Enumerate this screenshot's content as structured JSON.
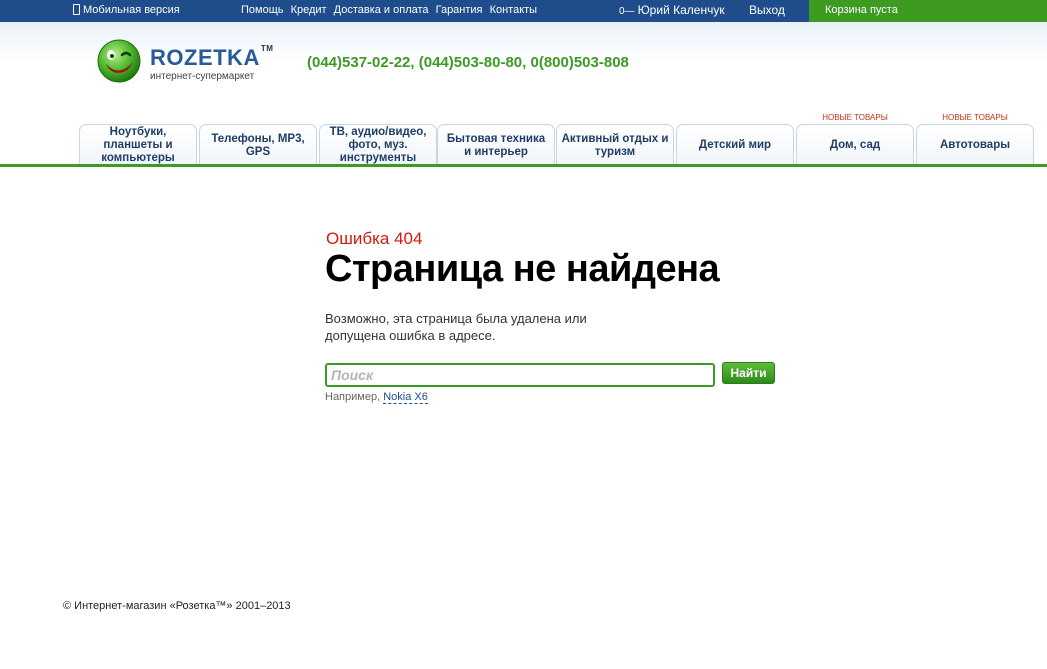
{
  "topbar": {
    "mobile": "Мобильная версия",
    "links": [
      "Помощь",
      "Кредит",
      "Доставка и оплата",
      "Гарантия",
      "Контакты"
    ],
    "user_key": "0—",
    "user": "Юрий Каленчук",
    "logout": "Выход",
    "cart": "Корзина пуста"
  },
  "header": {
    "logo": "ROZETKA",
    "logo_tm": "TM",
    "logo_sub": "интернет-супермаркет",
    "phones": "(044)537-02-22, (044)503-80-80, 0(800)503-808"
  },
  "categories": [
    {
      "label": "Ноутбуки, планшеты и компьютеры",
      "badge": ""
    },
    {
      "label": "Телефоны, MP3, GPS",
      "badge": ""
    },
    {
      "label": "ТВ, аудио/видео, фото, муз. инструменты",
      "badge": ""
    },
    {
      "label": "Бытовая техника и интерьер",
      "badge": ""
    },
    {
      "label": "Активный отдых и туризм",
      "badge": ""
    },
    {
      "label": "Детский мир",
      "badge": ""
    },
    {
      "label": "Дом, сад",
      "badge": "НОВЫЕ ТОВАРЫ"
    },
    {
      "label": "Автотовары",
      "badge": "НОВЫЕ ТОВАРЫ"
    }
  ],
  "main": {
    "error_code": "Ошибка 404",
    "title": "Страница не найдена",
    "description": "Возможно, эта страница была удалена или допущена ошибка в адресе.",
    "search_placeholder": "Поиск",
    "search_button": "Найти",
    "example_prefix": "Например,",
    "example_link": "Nokia X6"
  },
  "footer": {
    "copyright": "© Интернет-магазин «Розетка™» 2001–2013"
  },
  "colors": {
    "topbar": "#1f4c8a",
    "brand_green": "#3c9a25",
    "error_red": "#d21a0e"
  }
}
